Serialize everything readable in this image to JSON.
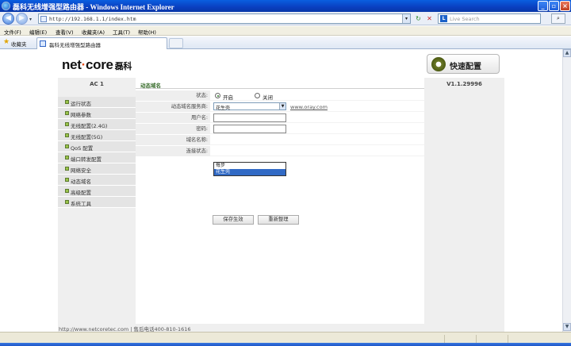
{
  "window": {
    "title": "磊科无线增强型路由器 - Windows Internet Explorer",
    "minimize": "_",
    "maximize": "▫",
    "close": "×"
  },
  "addressbar": {
    "url": "http://192.168.1.1/index.htm",
    "back_glyph": "◀",
    "forward_glyph": "▶",
    "refresh_glyph": "↻",
    "stop_glyph": "✕",
    "search_placeholder": "Live Search",
    "search_glyph": "⌕"
  },
  "menubar": {
    "items": [
      "文件(F)",
      "编辑(E)",
      "查看(V)",
      "收藏夹(A)",
      "工具(T)",
      "帮助(H)"
    ]
  },
  "favbar": {
    "favorites_label": "收藏夹",
    "tab_title": "磊科无线增强型路由器"
  },
  "router": {
    "logo_main": "net",
    "logo_dot": "·",
    "logo_rest": "core",
    "logo_cn": "磊科",
    "quick_setup": "快速配置",
    "model": "AC 1",
    "version": "V1.1.29996",
    "nav": [
      "运行状态",
      "网络参数",
      "无线配置(2.4G)",
      "无线配置(5G)",
      "QoS 配置",
      "端口转发配置",
      "网络安全",
      "动态域名",
      "高级配置",
      "系统工具"
    ],
    "section_title": "动态域名",
    "form": {
      "status_label": "状态:",
      "status_on": "开启",
      "status_off": "关闭",
      "provider_label": "动态域名服务商:",
      "provider_value": "花生壳",
      "provider_link": "www.oray.com",
      "provider_options": [
        "每步",
        "花生壳"
      ],
      "username_label": "用户名:",
      "password_label": "密码:",
      "domain_label": "域名名称:",
      "connection_label": "连接状态:",
      "save_button": "保存生效",
      "reset_button": "重新整理"
    },
    "footer": "http://www.netcoretec.com | 售后电话400-810-1616"
  },
  "colors": {
    "titlebar": "#0a4fd0",
    "section_title": "#3b6e2e",
    "selected_option": "#316ac5"
  }
}
